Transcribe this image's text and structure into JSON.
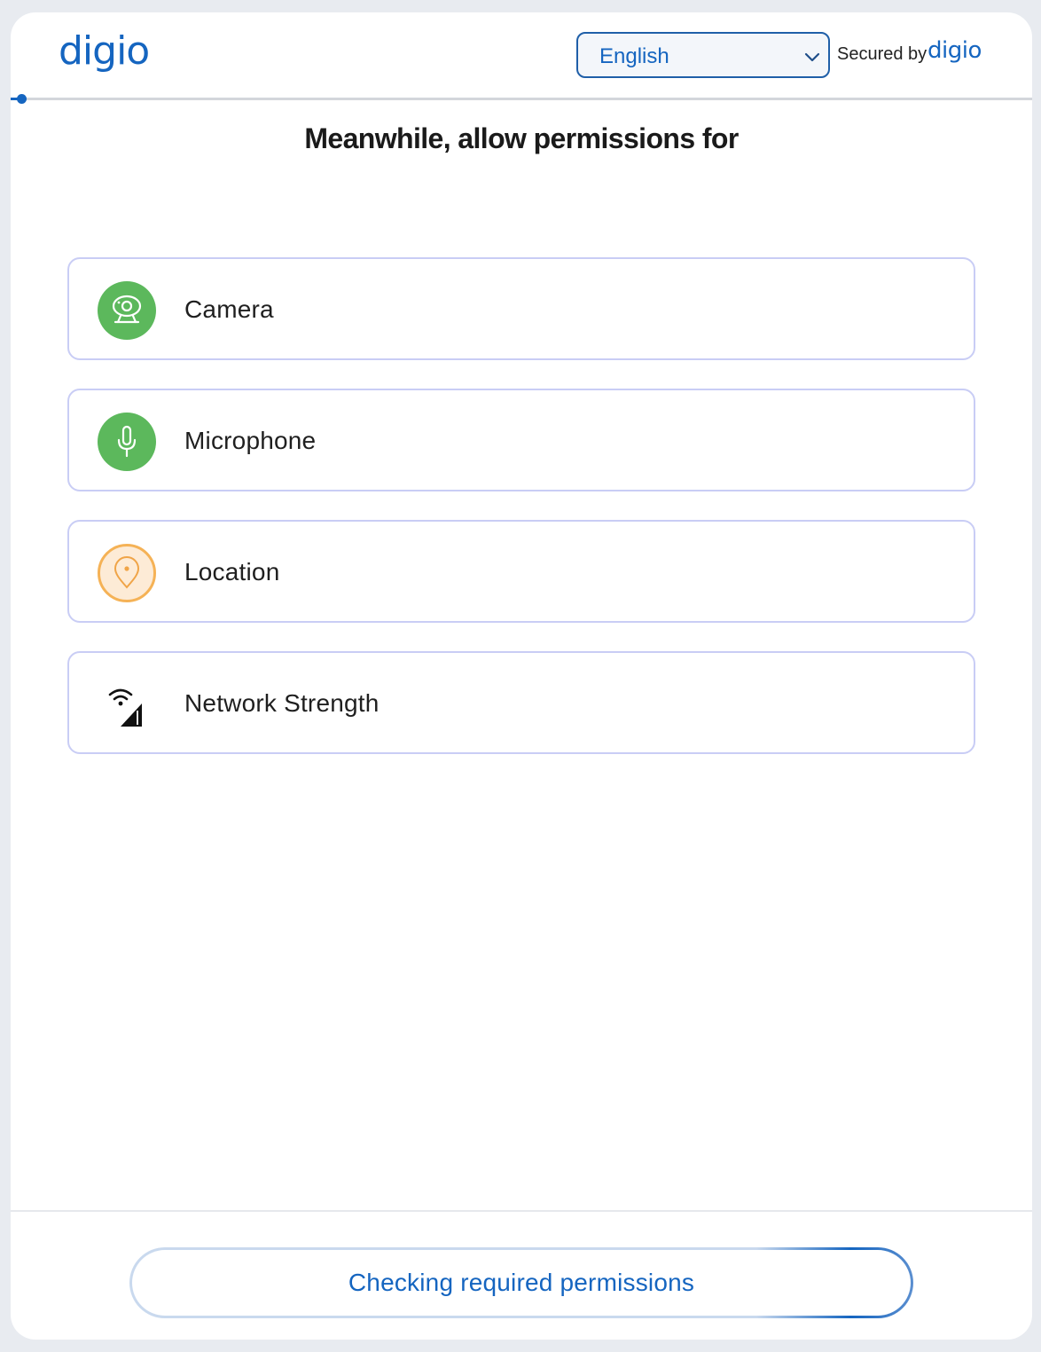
{
  "header": {
    "logo_text": "digio",
    "language": {
      "selected": "English"
    },
    "secured_by_label": "Secured by",
    "secured_by_logo": "digio"
  },
  "progress": {
    "value": 0
  },
  "title": "Meanwhile, allow permissions for",
  "permissions": [
    {
      "label": "Camera",
      "icon": "webcam-icon",
      "status_color": "#5cb85c"
    },
    {
      "label": "Microphone",
      "icon": "microphone-icon",
      "status_color": "#5cb85c"
    },
    {
      "label": "Location",
      "icon": "location-pin-icon",
      "status_color": "#f5b256"
    },
    {
      "label": "Network Strength",
      "icon": "network-signal-icon",
      "status_color": "#111111"
    }
  ],
  "footer": {
    "button_label": "Checking required permissions"
  },
  "colors": {
    "brand": "#1565c0",
    "granted": "#5cb85c",
    "pending": "#f5b256",
    "row_border": "#c9cdf5"
  }
}
